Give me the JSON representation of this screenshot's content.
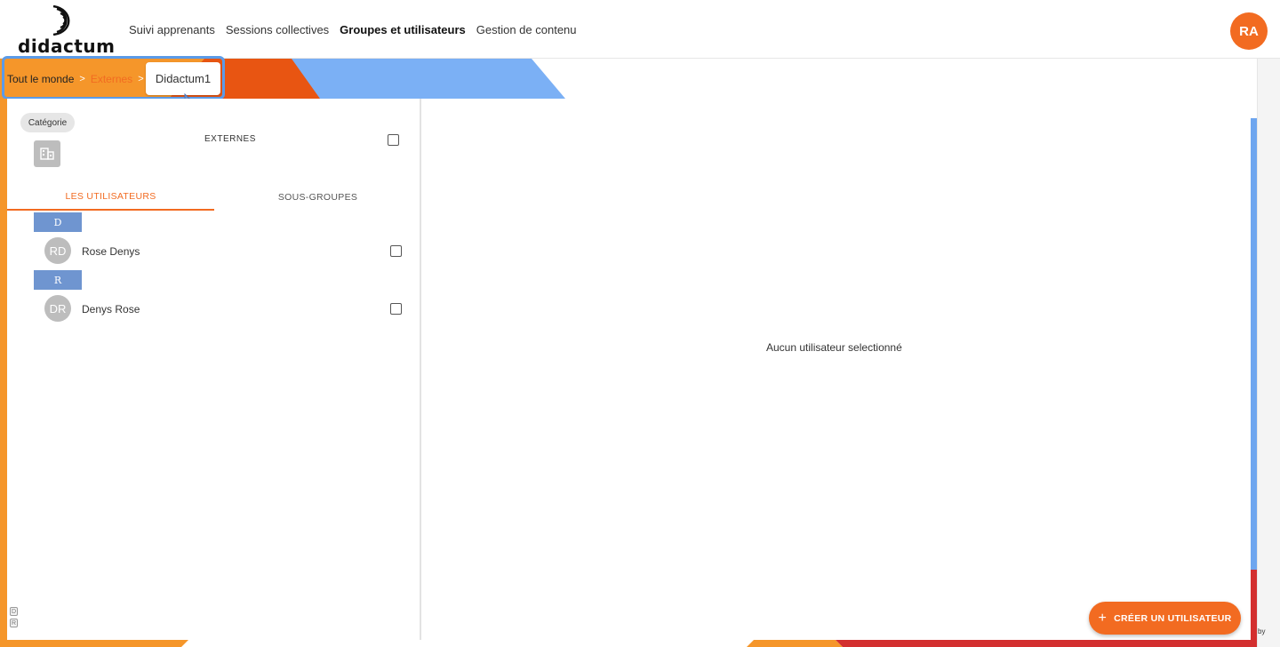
{
  "brand": {
    "name": "didactum"
  },
  "nav": {
    "items": [
      {
        "label": "Suivi apprenants"
      },
      {
        "label": "Sessions collectives"
      },
      {
        "label": "Groupes et utilisateurs"
      },
      {
        "label": "Gestion de contenu"
      }
    ],
    "user_initials": "RA"
  },
  "colors": {
    "accent": "#f26b21",
    "orange": "#f5962a",
    "blue": "#6ea6ef",
    "red": "#d32f2f"
  },
  "breadcrumb": {
    "root": "Tout le monde",
    "middle": "Externes",
    "current": "Didactum1",
    "separator": ">"
  },
  "group": {
    "category_label": "Catégorie",
    "name": "EXTERNES",
    "icon": "building-icon"
  },
  "tabs": {
    "users": "LES UTILISATEURS",
    "subgroups": "SOUS-GROUPES"
  },
  "user_groups": [
    {
      "letter": "D",
      "users": [
        {
          "initials": "RD",
          "name": "Rose Denys"
        }
      ]
    },
    {
      "letter": "R",
      "users": [
        {
          "initials": "DR",
          "name": "Denys Rose"
        }
      ]
    }
  ],
  "mini_tags": [
    "D",
    "R"
  ],
  "main": {
    "empty_message": "Aucun utilisateur selectionné"
  },
  "actions": {
    "create_user": "CRÉER UN UTILISATEUR"
  },
  "footer": {
    "by": "by"
  }
}
